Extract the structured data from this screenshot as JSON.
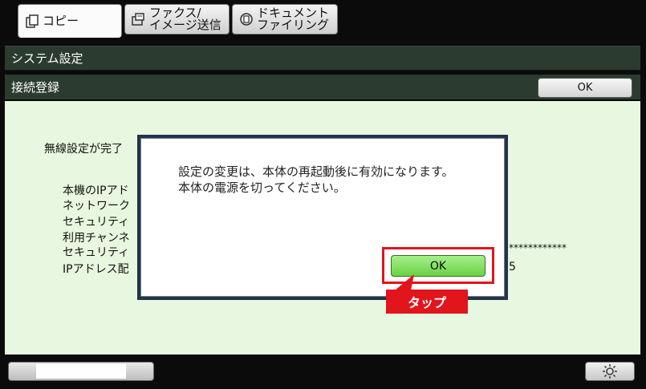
{
  "tabs": [
    {
      "label": "コピー",
      "icon": "copy-icon"
    },
    {
      "label": "ファクス/\nイメージ送信",
      "icon": "fax-icon"
    },
    {
      "label": "ドキュメント\nファイリング",
      "icon": "document-filing-icon"
    }
  ],
  "header": {
    "system_title": "システム設定",
    "section_title": "接続登録",
    "ok_label": "OK"
  },
  "panel": {
    "intro": "無線設定が完了",
    "lines": [
      "本機のIPアド",
      "ネットワーク",
      "セキュリティ",
      "利用チャンネ",
      "セキュリティ",
      "IPアドレス配"
    ],
    "masked_value": "************",
    "trailing_digit": "5"
  },
  "dialog": {
    "message_line1": "設定の変更は、本体の再起動後に有効になります。",
    "message_line2": "本体の電源を切ってください。",
    "ok_label": "OK"
  },
  "annotation": {
    "tap_label": "タップ",
    "highlight_color": "#e2141c"
  },
  "footer": {
    "brightness_icon": "brightness-icon"
  }
}
